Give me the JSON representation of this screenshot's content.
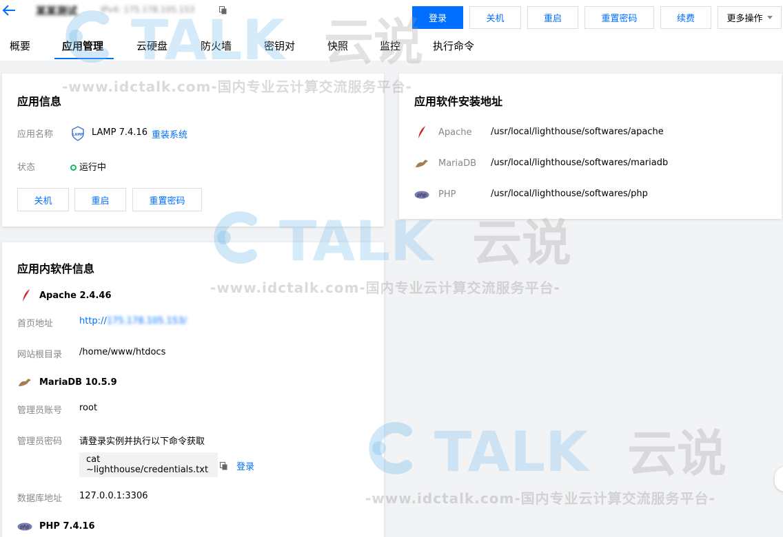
{
  "header": {
    "title": "某某测试",
    "ip": "IPv4: 175.178.105.153",
    "buttons": {
      "login": "登录",
      "shutdown": "关机",
      "restart": "重启",
      "reset_password": "重置密码",
      "renew": "续费",
      "more": "更多操作"
    }
  },
  "tabs": [
    "概要",
    "应用管理",
    "云硬盘",
    "防火墙",
    "密钥对",
    "快照",
    "监控",
    "执行命令"
  ],
  "app_info": {
    "title": "应用信息",
    "name_label": "应用名称",
    "lamp_icon_text": "LAMP",
    "name_value": "LAMP 7.4.16",
    "reinstall_link": "重装系统",
    "status_label": "状态",
    "status_value": "运行中",
    "buttons": {
      "shutdown": "关机",
      "restart": "重启",
      "reset_password": "重置密码"
    }
  },
  "install_paths": {
    "title": "应用软件安装地址",
    "rows": [
      {
        "name": "Apache",
        "path": "/usr/local/lighthouse/softwares/apache"
      },
      {
        "name": "MariaDB",
        "path": "/usr/local/lighthouse/softwares/mariadb"
      },
      {
        "name": "PHP",
        "path": "/usr/local/lighthouse/softwares/php"
      }
    ]
  },
  "software_info": {
    "title": "应用内软件信息",
    "apache": {
      "name": "Apache 2.4.46",
      "homepage_label": "首页地址",
      "homepage_prefix": "http://",
      "homepage_ip": "175.178.105.153/",
      "docroot_label": "网站根目录",
      "docroot_value": "/home/www/htdocs"
    },
    "mariadb": {
      "name": "MariaDB 10.5.9",
      "admin_account_label": "管理员账号",
      "admin_account_value": "root",
      "admin_password_label": "管理员密码",
      "admin_password_hint": "请登录实例并执行以下命令获取",
      "command": "cat ~lighthouse/credentials.txt",
      "login_link": "登录",
      "db_address_label": "数据库地址",
      "db_address_value": "127.0.0.1:3306"
    },
    "php": {
      "name": "PHP 7.4.16"
    }
  },
  "watermark": {
    "brand": "TALK",
    "brand_cn": "云说",
    "url": "-www.idctalk.com-国内专业云计算交流服务平台-"
  },
  "colors": {
    "accent": "#006eff",
    "running": "#0abf5b",
    "apache": "#d22128"
  },
  "icons": [
    "back-arrow-icon",
    "copy-icon",
    "lamp-shield-icon",
    "apache-feather-icon",
    "mariadb-seal-icon",
    "php-logo-icon",
    "status-dot-icon",
    "caret-down-icon"
  ]
}
